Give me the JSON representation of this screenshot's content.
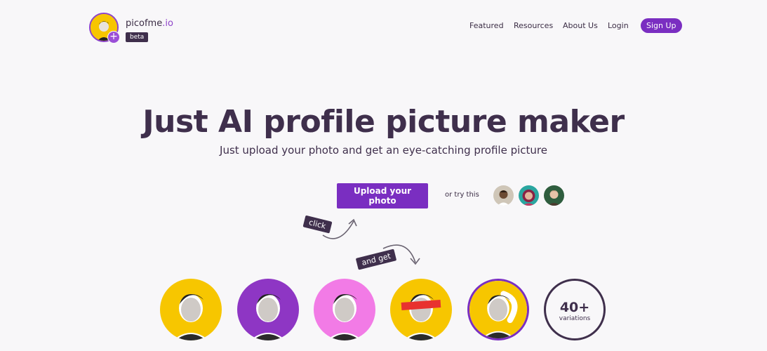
{
  "header": {
    "brand_name": "picofme",
    "brand_tld": ".io",
    "beta_label": "beta",
    "nav": [
      "Featured",
      "Resources",
      "About Us",
      "Login"
    ],
    "signup_label": "Sign Up"
  },
  "hero": {
    "title": "Just AI profile picture maker",
    "subtitle": "Just upload your photo and get an eye-catching profile picture",
    "upload_label": "Upload your photo",
    "try_label": "or try this",
    "click_tag": "click",
    "get_tag": "and get"
  },
  "variations": {
    "count": "40+",
    "label": "variations"
  },
  "colors": {
    "accent": "#7a2ec1",
    "dark": "#3f2f4c",
    "yellow": "#f7c600",
    "pink": "#f27be6",
    "purple": "#8e36c4"
  }
}
